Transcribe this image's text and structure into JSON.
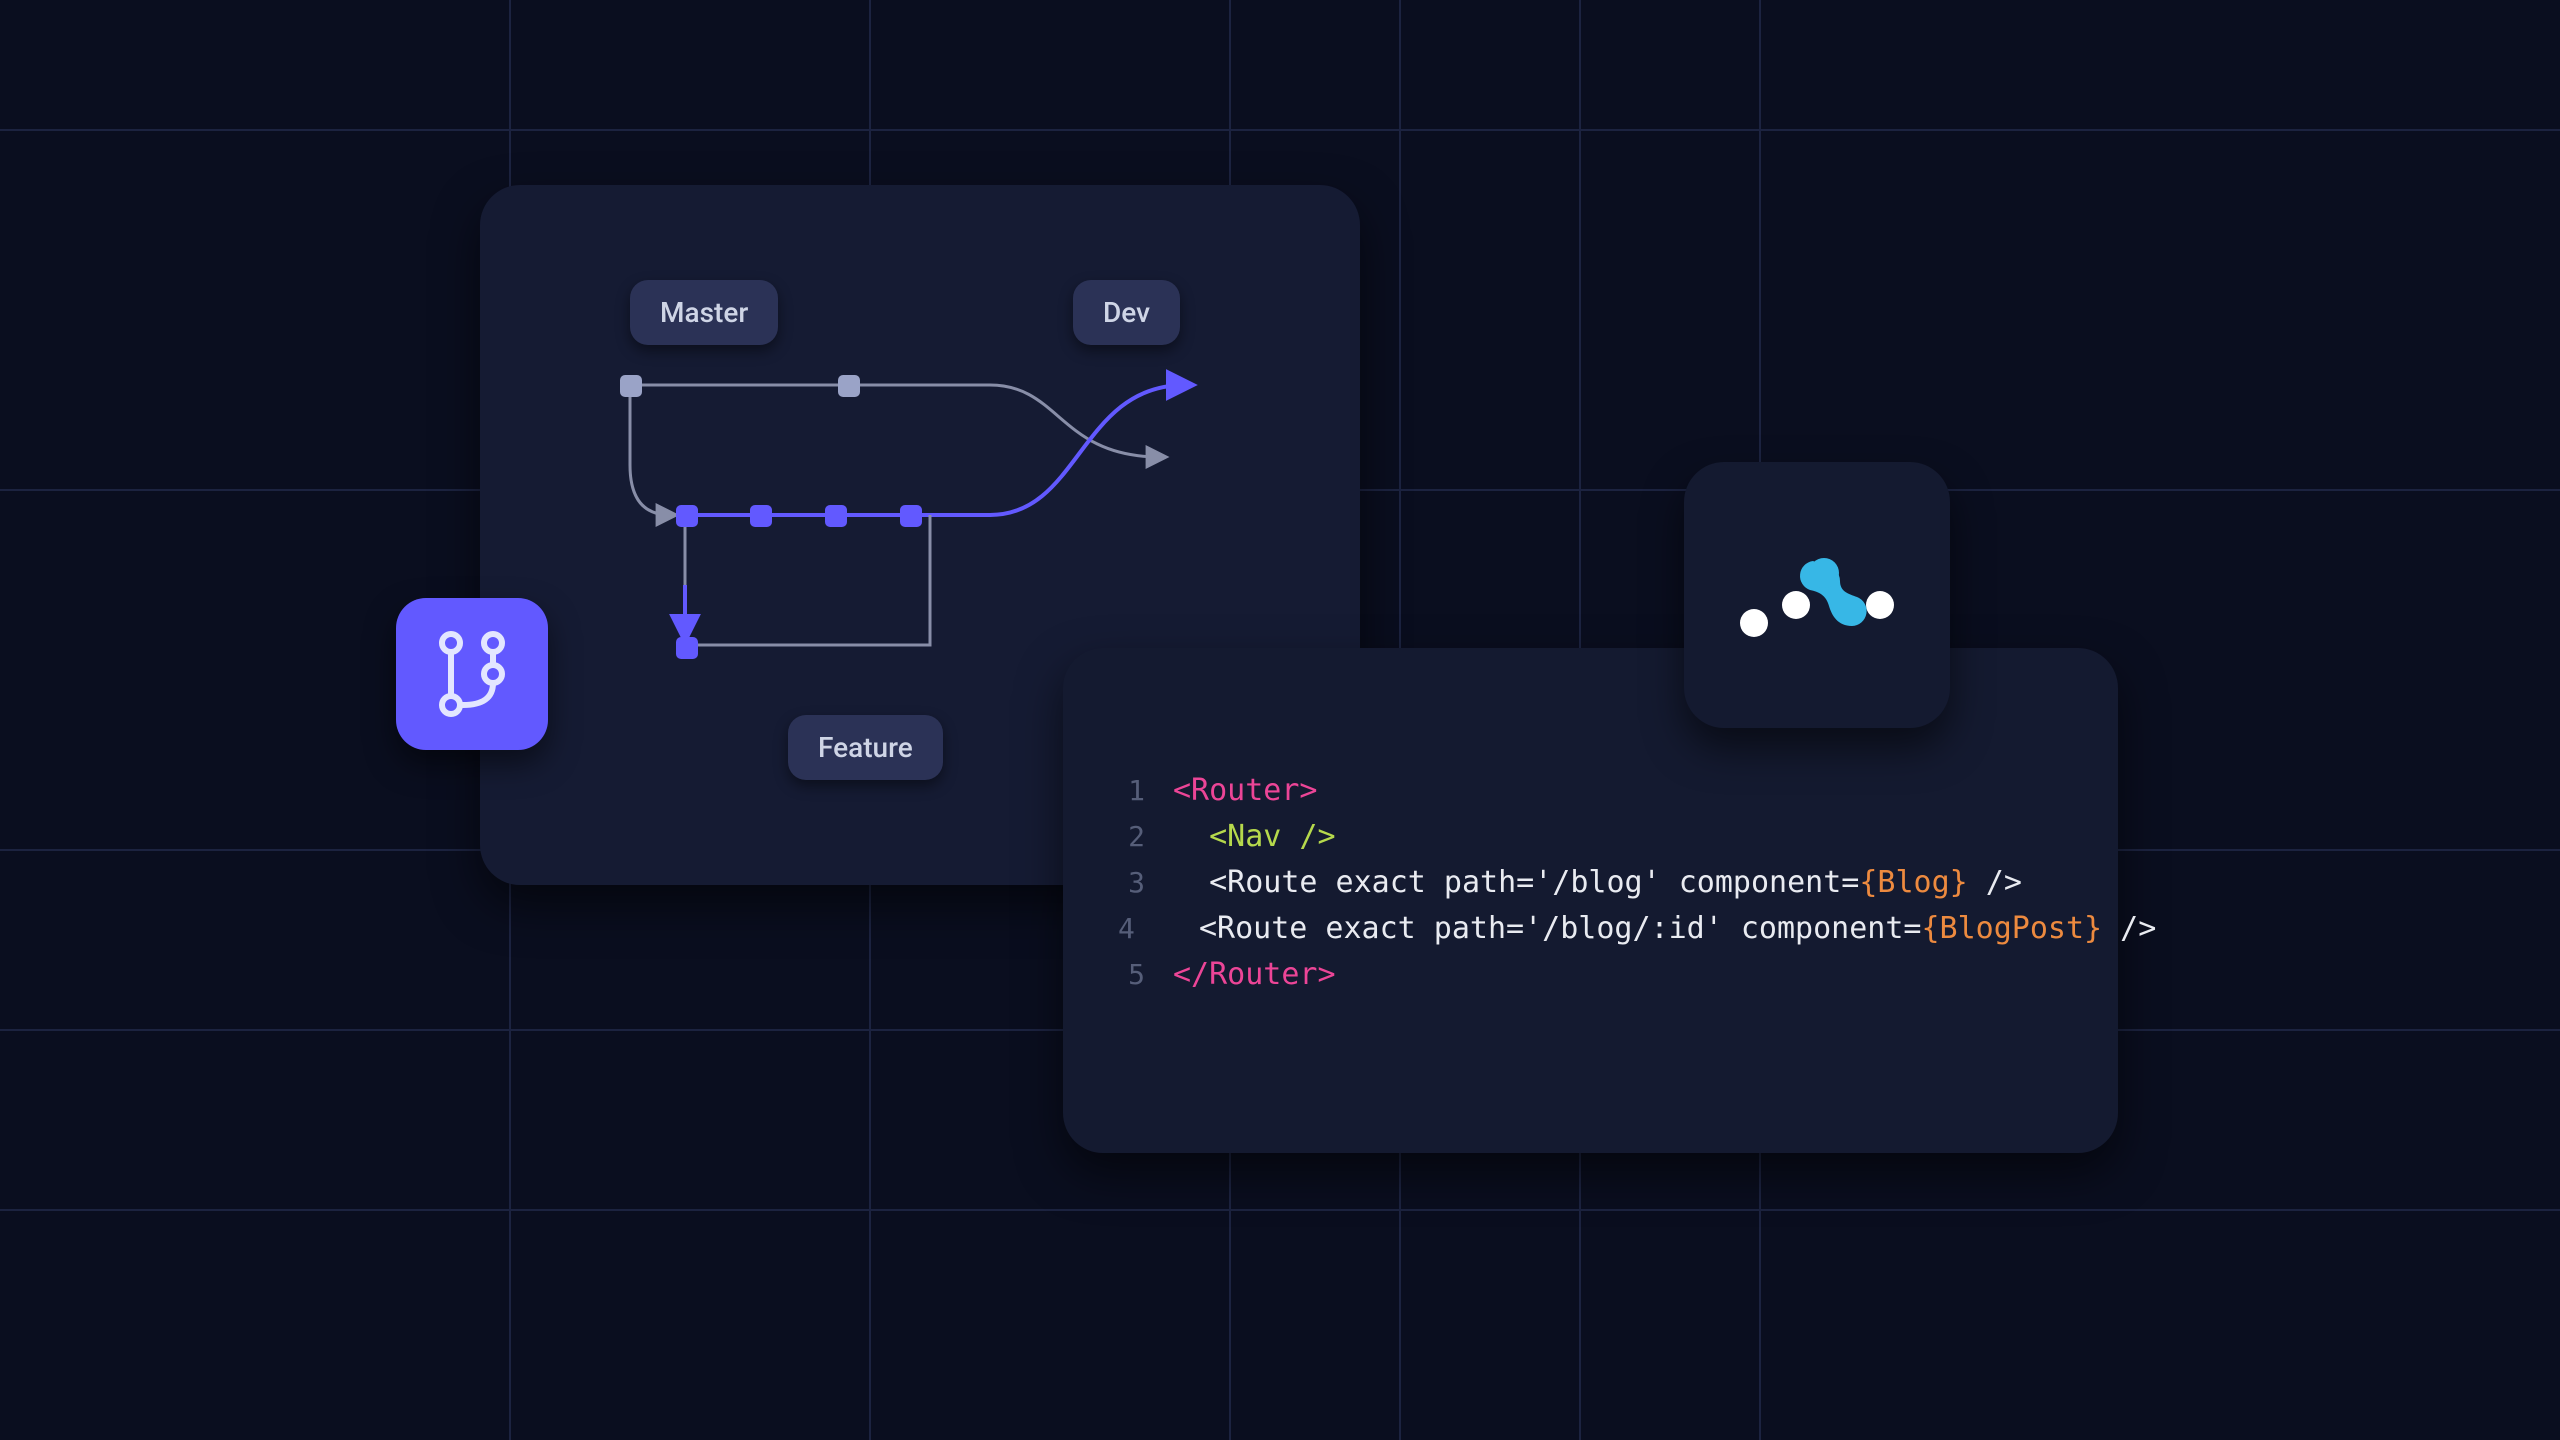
{
  "git": {
    "branches": {
      "master": "Master",
      "dev": "Dev",
      "feature": "Feature"
    },
    "icon": "git-branch-icon"
  },
  "logo": {
    "name": "react-router-logo-icon"
  },
  "code": {
    "lines": [
      {
        "n": "1",
        "tokens": [
          {
            "t": "<Router>",
            "c": "c-pink"
          }
        ]
      },
      {
        "n": "2",
        "tokens": [
          {
            "t": "  ",
            "c": "c-white"
          },
          {
            "t": "<Nav />",
            "c": "c-green"
          }
        ]
      },
      {
        "n": "3",
        "tokens": [
          {
            "t": "  ",
            "c": "c-white"
          },
          {
            "t": "<Route exact path='/blog' component=",
            "c": "c-white"
          },
          {
            "t": "{Blog}",
            "c": "c-orange"
          },
          {
            "t": " />",
            "c": "c-white"
          }
        ]
      },
      {
        "n": "4",
        "tokens": [
          {
            "t": "  ",
            "c": "c-white"
          },
          {
            "t": "<Route exact path='/blog/:id' component=",
            "c": "c-white"
          },
          {
            "t": "{BlogPost}",
            "c": "c-orange"
          },
          {
            "t": " />",
            "c": "c-white"
          }
        ]
      },
      {
        "n": "5",
        "tokens": [
          {
            "t": "</Router>",
            "c": "c-pink"
          }
        ]
      }
    ]
  },
  "colors": {
    "panel": "#151b33",
    "accent": "#6259ff",
    "pink": "#ec4597",
    "green": "#b6d94c",
    "orange": "#ed8a3f",
    "white": "#e9ebf1"
  }
}
